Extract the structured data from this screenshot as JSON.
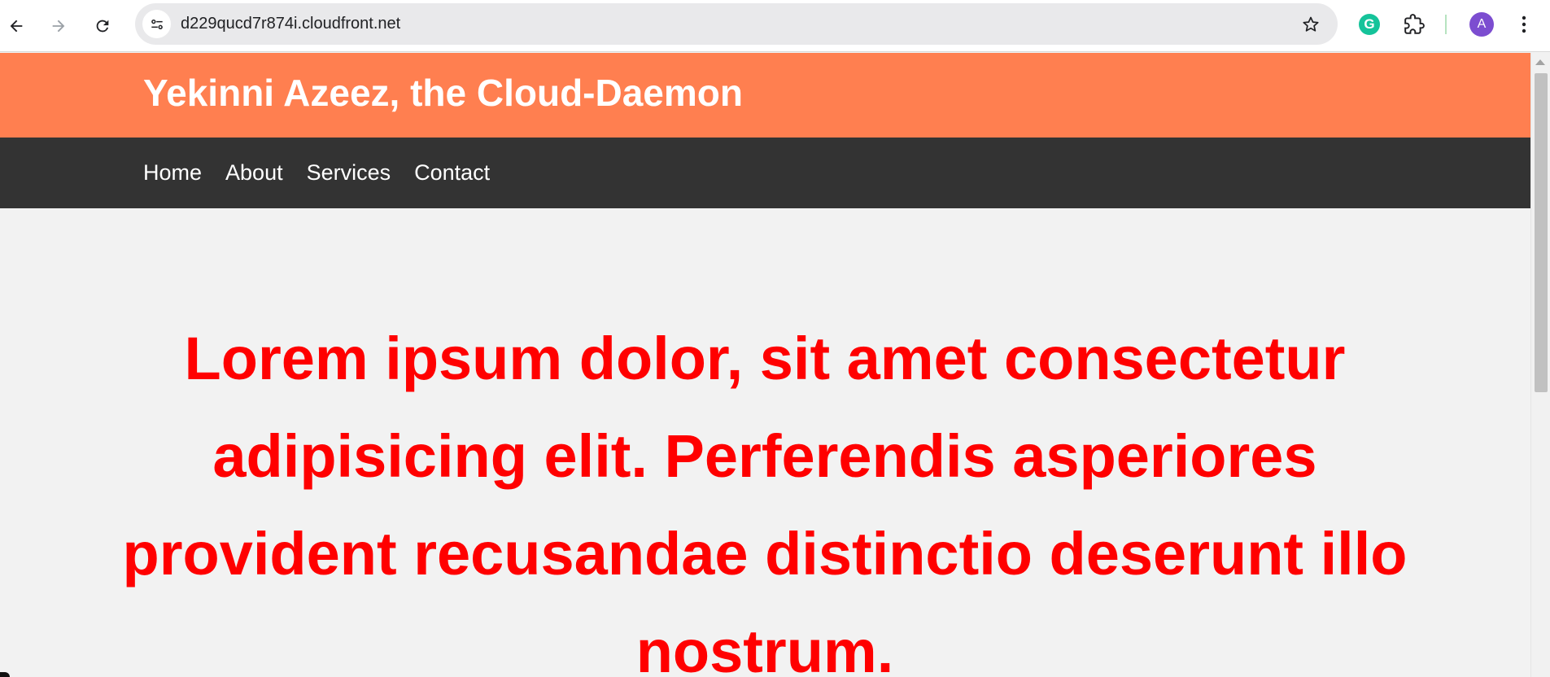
{
  "browser": {
    "url": "d229qucd7r874i.cloudfront.net",
    "profile_initial": "A",
    "icons": {
      "back": "arrow-left-icon",
      "forward": "arrow-right-icon",
      "reload": "reload-icon",
      "site_info": "tune-icon",
      "bookmark": "star-icon",
      "grammarly": "grammarly-icon",
      "extensions": "puzzle-icon",
      "menu": "kebab-menu-icon"
    },
    "colors": {
      "avatar": "#7c4dd0",
      "grammarly": "#15c39a"
    }
  },
  "page": {
    "header": {
      "title": "Yekinni Azeez, the Cloud-Daemon"
    },
    "nav": {
      "items": [
        {
          "label": "Home"
        },
        {
          "label": "About"
        },
        {
          "label": "Services"
        },
        {
          "label": "Contact"
        }
      ]
    },
    "hero": {
      "heading": "Lorem ipsum dolor, sit amet consectetur adipisicing elit. Perferendis asperiores provident recusandae distinctio deserunt illo nostrum."
    },
    "colors": {
      "header_bg": "#ff7f50",
      "nav_bg": "#333333",
      "body_bg": "#f2f2f2",
      "heading": "#ff0000"
    }
  }
}
